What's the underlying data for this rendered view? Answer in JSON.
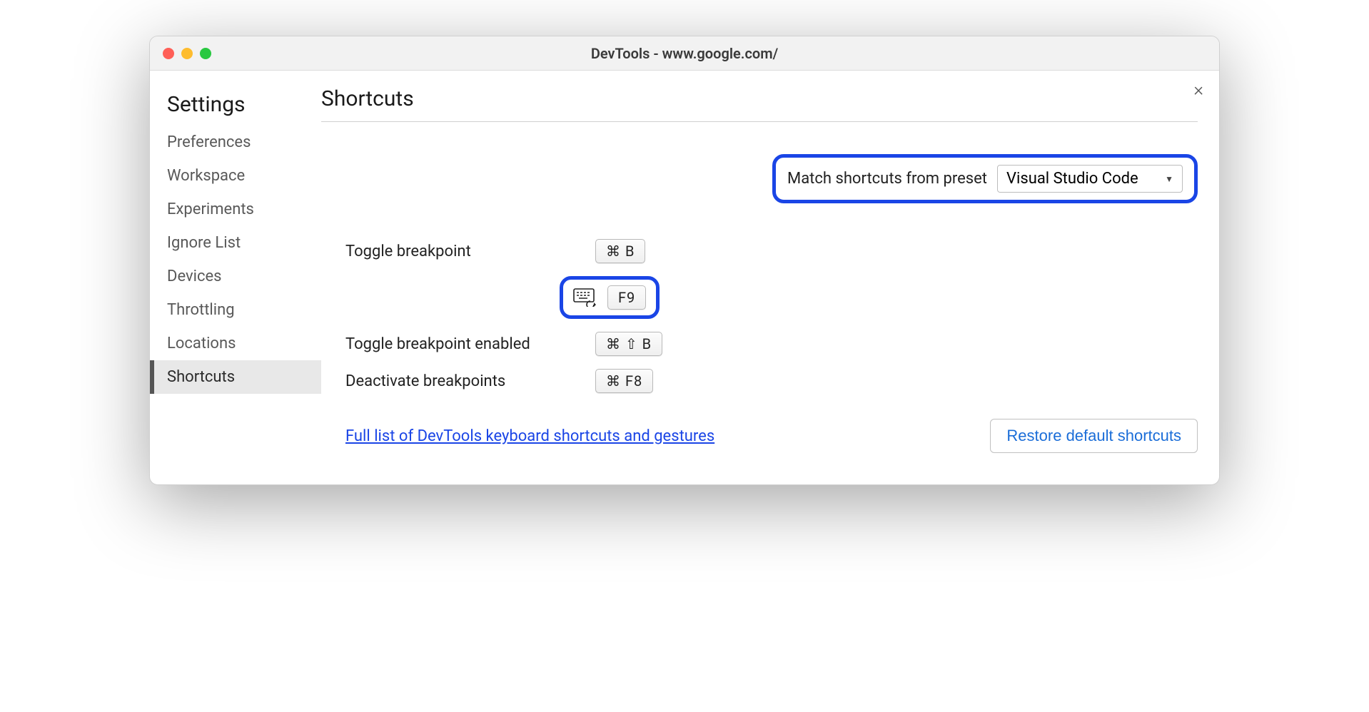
{
  "window": {
    "title": "DevTools - www.google.com/"
  },
  "sidebar": {
    "title": "Settings",
    "items": [
      {
        "label": "Preferences"
      },
      {
        "label": "Workspace"
      },
      {
        "label": "Experiments"
      },
      {
        "label": "Ignore List"
      },
      {
        "label": "Devices"
      },
      {
        "label": "Throttling"
      },
      {
        "label": "Locations"
      },
      {
        "label": "Shortcuts"
      }
    ]
  },
  "main": {
    "title": "Shortcuts",
    "preset": {
      "label": "Match shortcuts from preset",
      "selected": "Visual Studio Code"
    },
    "shortcuts": {
      "toggle_breakpoint": {
        "label": "Toggle breakpoint",
        "keys": "⌘ B"
      },
      "f9": {
        "keys": "F9"
      },
      "toggle_breakpoint_enabled": {
        "label": "Toggle breakpoint enabled",
        "keys": "⌘ ⇧ B"
      },
      "deactivate_breakpoints": {
        "label": "Deactivate breakpoints",
        "keys": "⌘ F8"
      }
    },
    "link": "Full list of DevTools keyboard shortcuts and gestures",
    "restore": "Restore default shortcuts"
  }
}
